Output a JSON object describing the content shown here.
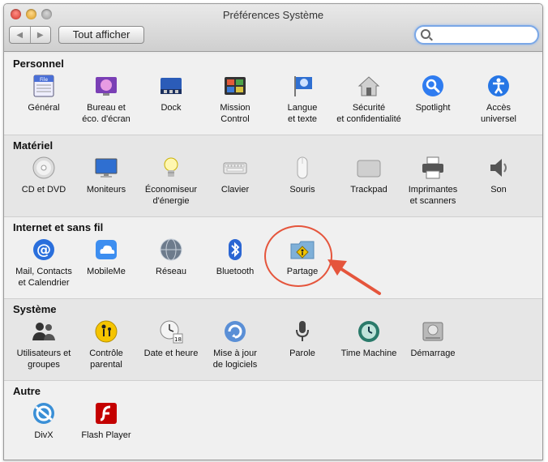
{
  "window": {
    "title": "Préférences Système"
  },
  "toolbar": {
    "back_glyph": "◀",
    "forward_glyph": "▶",
    "show_all_label": "Tout afficher",
    "search_value": "",
    "search_placeholder": ""
  },
  "sections": [
    {
      "title": "Personnel",
      "items": [
        {
          "label": "Général",
          "icon": "general-icon"
        },
        {
          "label": "Bureau et\néco. d'écran",
          "icon": "desktop-screensaver-icon"
        },
        {
          "label": "Dock",
          "icon": "dock-icon"
        },
        {
          "label": "Mission\nControl",
          "icon": "mission-control-icon"
        },
        {
          "label": "Langue\net texte",
          "icon": "language-flag-icon"
        },
        {
          "label": "Sécurité\net confidentialité",
          "icon": "security-house-icon"
        },
        {
          "label": "Spotlight",
          "icon": "spotlight-icon"
        },
        {
          "label": "Accès\nuniversel",
          "icon": "accessibility-icon"
        }
      ]
    },
    {
      "title": "Matériel",
      "items": [
        {
          "label": "CD et DVD",
          "icon": "cd-dvd-icon"
        },
        {
          "label": "Moniteurs",
          "icon": "monitor-icon"
        },
        {
          "label": "Économiseur\nd'énergie",
          "icon": "energy-bulb-icon"
        },
        {
          "label": "Clavier",
          "icon": "keyboard-icon"
        },
        {
          "label": "Souris",
          "icon": "mouse-icon"
        },
        {
          "label": "Trackpad",
          "icon": "trackpad-icon"
        },
        {
          "label": "Imprimantes\net scanners",
          "icon": "printer-icon"
        },
        {
          "label": "Son",
          "icon": "speaker-icon"
        }
      ]
    },
    {
      "title": "Internet et sans fil",
      "items": [
        {
          "label": "Mail, Contacts\net Calendrier",
          "icon": "mail-at-icon"
        },
        {
          "label": "MobileMe",
          "icon": "mobileme-cloud-icon"
        },
        {
          "label": "Réseau",
          "icon": "network-globe-icon"
        },
        {
          "label": "Bluetooth",
          "icon": "bluetooth-icon"
        },
        {
          "label": "Partage",
          "icon": "sharing-folder-icon"
        }
      ]
    },
    {
      "title": "Système",
      "items": [
        {
          "label": "Utilisateurs et\ngroupes",
          "icon": "users-groups-icon"
        },
        {
          "label": "Contrôle\nparental",
          "icon": "parental-control-icon"
        },
        {
          "label": "Date et heure",
          "icon": "date-time-icon"
        },
        {
          "label": "Mise à jour\nde logiciels",
          "icon": "software-update-icon"
        },
        {
          "label": "Parole",
          "icon": "microphone-icon"
        },
        {
          "label": "Time Machine",
          "icon": "time-machine-icon"
        },
        {
          "label": "Démarrage",
          "icon": "startup-disk-icon"
        }
      ]
    },
    {
      "title": "Autre",
      "items": [
        {
          "label": "DivX",
          "icon": "divx-icon"
        },
        {
          "label": "Flash Player",
          "icon": "flash-player-icon"
        }
      ]
    }
  ],
  "colors": {
    "annotation": "#e5553c",
    "search_focus": "#7aa7e6"
  }
}
